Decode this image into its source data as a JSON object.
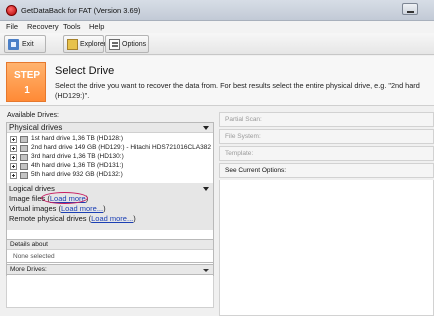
{
  "window": {
    "title": "GetDataBack for FAT (Version 3.69)"
  },
  "menu": [
    {
      "label": "File"
    },
    {
      "label": "Recovery"
    },
    {
      "label": "Tools"
    },
    {
      "label": "Help"
    }
  ],
  "toolbar": {
    "exit_label": "Exit",
    "explorer_label": "Explorer",
    "options_label": "Options"
  },
  "step": {
    "badge_word": "STEP",
    "badge_number": "1",
    "title": "Select Drive",
    "description": "Select the drive you want to recover the data from. For best results select the entire physical drive, e.g. \"2nd hard (HD129:)\"."
  },
  "left": {
    "available_label": "Available Drives:",
    "physical_label": "Physical drives",
    "drives": [
      "1st hard drive 1,36 TB (HD128:)",
      "2nd hard drive 149 GB (HD129:) - Hitachi HDS721016CLA382",
      "3rd hard drive 1,36 TB (HD130:)",
      "4th hard drive 1,36 TB (HD131:)",
      "5th hard drive 932 GB (HD132:)"
    ],
    "logical_label": "Logical drives",
    "image_files_label": "Image files",
    "image_files_link": "Load more",
    "virtual_label": "Virtual images",
    "virtual_link": "Load more...",
    "remote_label": "Remote physical drives",
    "remote_link": "Load more...",
    "details_label": "Details about",
    "details_value": "None selected",
    "more_drives_label": "More Drives:"
  },
  "right": {
    "partial_scan": "Partial Scan:",
    "file_system": "File System:",
    "template": "Template:",
    "current_options": "See Current Options:"
  }
}
